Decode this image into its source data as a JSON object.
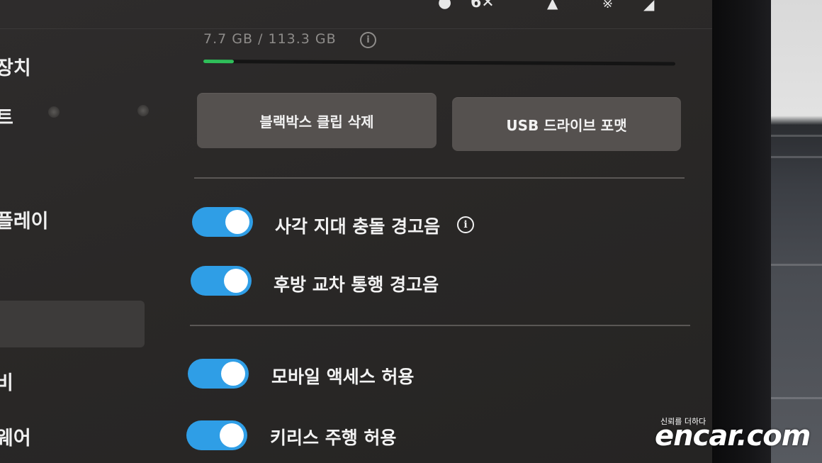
{
  "sidebar": {
    "items": [
      {
        "label": "장치"
      },
      {
        "label": "트"
      },
      {
        "label": "플레이"
      },
      {
        "label": "비"
      },
      {
        "label": "웨어"
      }
    ]
  },
  "storage": {
    "usage_text": "7.7 GB / 113.3 GB",
    "used_fraction": 0.065
  },
  "buttons": {
    "delete_clips": "블랙박스 클립 삭제",
    "format_usb": "USB 드라이브 포맷"
  },
  "toggles": [
    {
      "label": "사각 지대 충돌 경고음",
      "on": true,
      "has_info": true
    },
    {
      "label": "후방 교차 통행 경고음",
      "on": true,
      "has_info": false
    },
    {
      "label": "모바일 액세스 허용",
      "on": true,
      "has_info": false
    },
    {
      "label": "키리스 주행 허용",
      "on": true,
      "has_info": false
    }
  ],
  "watermark": {
    "tagline": "신뢰를 더하다",
    "logo": "encar.com"
  },
  "colors": {
    "toggle_on": "#2f9ee6",
    "storage_fill": "#2fbf5a",
    "background": "#2b2928"
  },
  "icons": {
    "status": [
      "person-icon",
      "signal-icon",
      "bell-icon",
      "bluetooth-icon",
      "cellular-signal-icon"
    ]
  }
}
